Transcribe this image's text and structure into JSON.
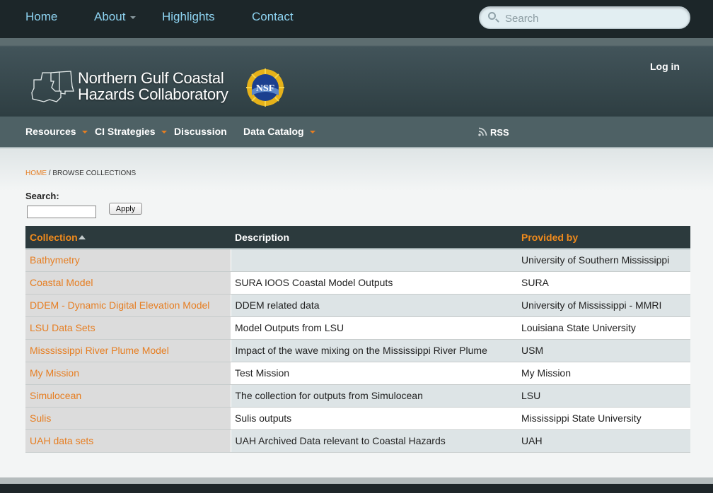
{
  "topnav": {
    "items": [
      {
        "label": "Home",
        "dropdown": false
      },
      {
        "label": "About",
        "dropdown": true
      },
      {
        "label": "Highlights",
        "dropdown": false
      },
      {
        "label": "Contact",
        "dropdown": false
      }
    ],
    "search_placeholder": "Search"
  },
  "header": {
    "logo_line1": "Northern Gulf Coastal",
    "logo_line2": "Hazards Collaboratory",
    "nsf_label": "NSF",
    "login": "Log in"
  },
  "subnav": {
    "items": [
      {
        "label": "Resources",
        "dropdown": true
      },
      {
        "label": "CI Strategies",
        "dropdown": true
      },
      {
        "label": "Discussion",
        "dropdown": false
      },
      {
        "label": "Data Catalog",
        "dropdown": true
      }
    ],
    "rss": "RSS"
  },
  "breadcrumb": {
    "home": "HOME",
    "separator": "/",
    "current": "BROWSE COLLECTIONS"
  },
  "filter": {
    "label": "Search:",
    "value": "",
    "apply": "Apply"
  },
  "table": {
    "headers": [
      "Collection",
      "Description",
      "Provided by"
    ],
    "sort_column": "Collection",
    "sort_direction": "ascending",
    "rows": [
      [
        "Bathymetry",
        "",
        "University of Southern Mississippi"
      ],
      [
        "Coastal Model",
        "SURA IOOS Coastal Model Outputs",
        "SURA"
      ],
      [
        "DDEM - Dynamic Digital Elevation Model",
        "DDEM related data",
        "University of Mississippi - MMRI"
      ],
      [
        "LSU Data Sets",
        "Model Outputs from LSU",
        "Louisiana State University"
      ],
      [
        "Misssissippi River Plume Model",
        "Impact of the wave mixing on the Mississippi River Plume",
        "USM"
      ],
      [
        "My Mission",
        "Test Mission",
        "My Mission"
      ],
      [
        "Simulocean",
        "The collection for outputs from Simulocean",
        "LSU"
      ],
      [
        "Sulis",
        "Sulis outputs",
        "Mississippi State University"
      ],
      [
        "UAH data sets",
        "UAH Archived Data relevant to Coastal Hazards",
        "UAH"
      ]
    ]
  },
  "colors": {
    "accent": "#e67e22",
    "topnav_link": "#8ed4f2",
    "header_dark": "#2c3a3d"
  }
}
